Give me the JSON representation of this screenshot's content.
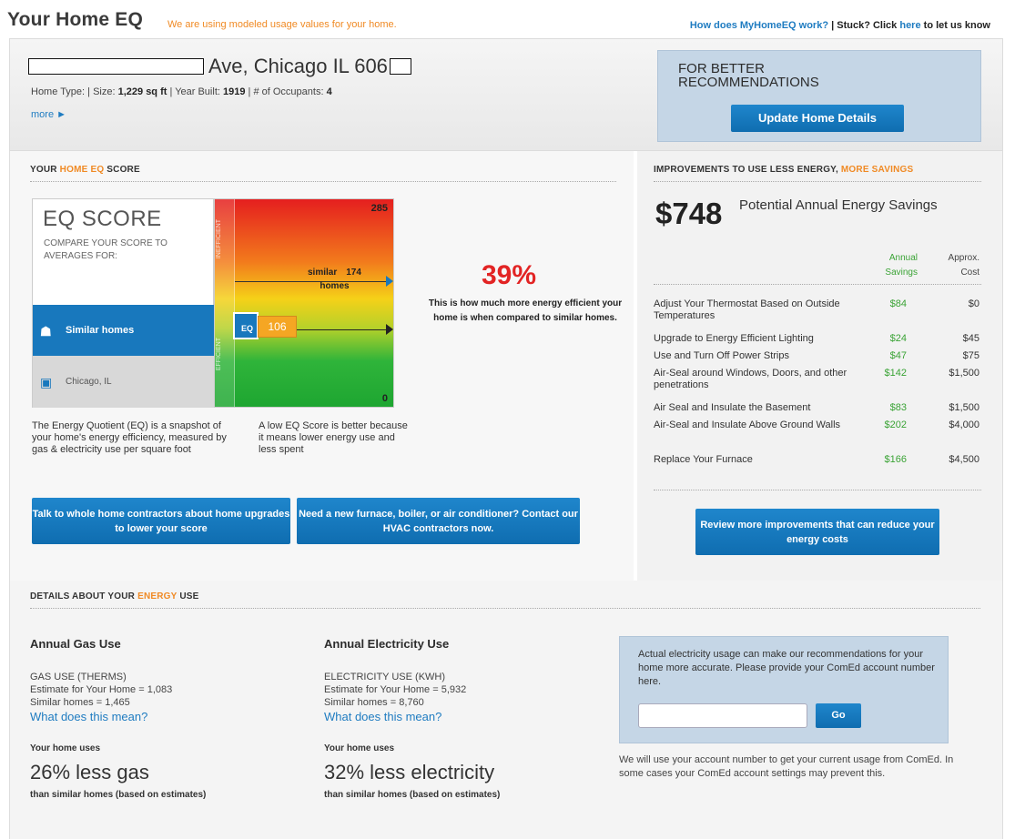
{
  "header": {
    "title": "Your Home EQ",
    "note": "We are using modeled usage values for your home.",
    "link_how": "How does MyHomeEQ work?",
    "stuck_prefix": " | Stuck? Click ",
    "link_here": "here",
    "stuck_suffix": " to let us know"
  },
  "home": {
    "address": "Ave, Chicago IL 606",
    "type_label": "Home Type: ",
    "size_label": " |  Size: ",
    "size_value": "1,229 sq ft",
    "year_label": "  |  Year Built: ",
    "year_value": "1919",
    "occ_label": "  |  # of Occupants: ",
    "occ_value": "4",
    "more": "more ►"
  },
  "better": {
    "title": "FOR BETTER RECOMMENDATIONS",
    "button": "Update Home Details"
  },
  "eq": {
    "section_pre": "YOUR ",
    "section_mid": "HOME EQ",
    "section_post": " SCORE",
    "title": "EQ SCORE",
    "subtitle": "COMPARE YOUR SCORE TO AVERAGES FOR:",
    "similar_homes": "Similar homes",
    "chicago": "Chicago, IL",
    "gauge_max": "285",
    "gauge_min": "0",
    "inefficient": "INEFFICIENT",
    "efficient": "EFFICIENT",
    "similar_label": "similar",
    "similar_value": "174",
    "similar_label2": "homes",
    "home_badge": "EQ",
    "home_score": "106",
    "pct": "39%",
    "pct_text": "This is how much more energy efficient your home is when compared to similar homes.",
    "desc1": "The Energy Quotient (EQ) is a snapshot of your home's energy efficiency, measured by gas & electricity use per square foot",
    "desc2": "A low EQ Score is better because it means lower energy use and less spent",
    "btn_contractors": "Talk to whole home contractors about home upgrades to lower your score",
    "btn_hvac": "Need a new furnace, boiler, or air conditioner? Contact our HVAC contractors now."
  },
  "improvements": {
    "section_pre": "IMPROVEMENTS TO USE LESS ENERGY, ",
    "section_orange": "MORE SAVINGS",
    "total": "$748",
    "total_label": "Potential Annual Energy Savings",
    "col_savings": "Annual Savings",
    "col_cost": "Approx. Cost",
    "items": [
      {
        "name": "Adjust Your Thermostat Based on Outside Temperatures",
        "savings": "$84",
        "cost": "$0"
      },
      {
        "name": "Upgrade to Energy Efficient Lighting",
        "savings": "$24",
        "cost": "$45"
      },
      {
        "name": "Use and Turn Off Power Strips",
        "savings": "$47",
        "cost": "$75"
      },
      {
        "name": "Air-Seal around Windows, Doors, and other penetrations",
        "savings": "$142",
        "cost": "$1,500"
      },
      {
        "name": "Air Seal and Insulate the Basement",
        "savings": "$83",
        "cost": "$1,500"
      },
      {
        "name": "Air-Seal and Insulate Above Ground Walls",
        "savings": "$202",
        "cost": "$4,000"
      },
      {
        "name": "Replace Your Furnace",
        "savings": "$166",
        "cost": "$4,500"
      }
    ],
    "review_btn": "Review more improvements that can reduce your energy costs"
  },
  "details": {
    "section_pre": "DETAILS ABOUT YOUR ",
    "section_orange": "ENERGY",
    "section_post": " USE",
    "gas": {
      "title": "Annual Gas Use",
      "line1": "GAS USE (THERMS)",
      "line2": "Estimate for Your Home = 1,083",
      "line3": "Similar homes = 1,465",
      "link": "What does this mean?",
      "uses": "Your home uses",
      "big": "26% less gas",
      "foot": "than similar homes (based on estimates)"
    },
    "elec": {
      "title": "Annual Electricity Use",
      "line1": "ELECTRICITY USE (KWH)",
      "line2": "Estimate for Your Home = 5,932",
      "line3": "Similar homes = 8,760",
      "link": "What does this mean?",
      "uses": "Your home uses",
      "big": "32% less electricity",
      "foot": "than similar homes (based on estimates)"
    },
    "account": {
      "text": "Actual electricity usage can make our recommendations for your home more accurate. Please provide your ComEd account number here.",
      "input_value": "",
      "go": "Go",
      "note": "We will use your account number to get your current usage from ComEd. In some cases your ComEd account settings may prevent this."
    }
  },
  "colors": {
    "accent_blue": "#1878bd",
    "orange": "#f08a24",
    "savings_green": "#3aa335",
    "pct_red": "#e22424"
  }
}
